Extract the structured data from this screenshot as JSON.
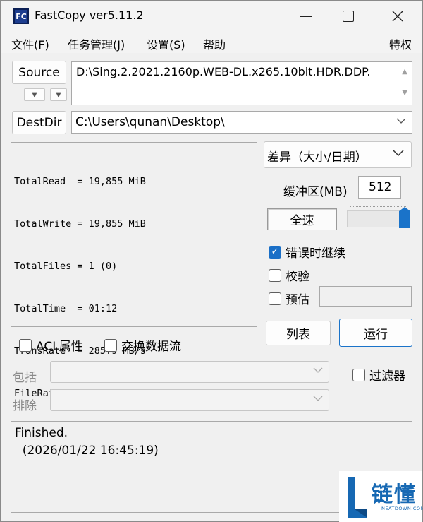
{
  "window": {
    "icon_text": "FC",
    "title": "FastCopy ver5.11.2"
  },
  "menu": {
    "file": "文件(F)",
    "tasks": "任务管理(J)",
    "settings": "设置(S)",
    "help": "帮助",
    "special": "特权"
  },
  "source": {
    "button": "Source",
    "path": "D:\\Sing.2.2021.2160p.WEB-DL.x265.10bit.HDR.DDP."
  },
  "destdir": {
    "button": "DestDir",
    "path": "C:\\Users\\qunan\\Desktop\\"
  },
  "stats": {
    "lines": [
      "TotalRead  = 19,855 MiB",
      "TotalWrite = 19,855 MiB",
      "TotalFiles = 1 (0)",
      "TotalTime  = 01:12",
      "TransRate  = 285.9 MB/s",
      "FileRate   = 0.01 files/s"
    ]
  },
  "options": {
    "mode": "差异（大小/日期）",
    "buffer_label": "缓冲区(MB)",
    "buffer_value": "512",
    "speed_label": "全速",
    "speed_level": 1.0,
    "continue_on_error": "错误时继续",
    "verify": "校验",
    "estimate": "预估"
  },
  "checks": {
    "continue_on_error": true,
    "verify": false,
    "estimate": false,
    "acl": false,
    "streams": false,
    "filter": false
  },
  "actions": {
    "list": "列表",
    "run": "运行"
  },
  "extra": {
    "acl": "ACL属性",
    "streams": "交换数据流",
    "filter": "过滤器",
    "include": "包括",
    "exclude": "排除"
  },
  "log": {
    "line1": "Finished.",
    "line2": "  (2026/01/22 16:45:19)"
  },
  "watermark": {
    "cn": "链懂",
    "en": "NEATDOWN.COM"
  },
  "colors": {
    "accent": "#1a73c9",
    "watermark": "#1668b3"
  }
}
